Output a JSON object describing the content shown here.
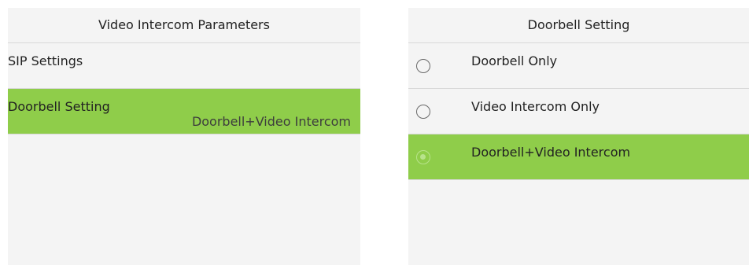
{
  "left_screen": {
    "title": "Video Intercom Parameters",
    "items": [
      {
        "label": "SIP Settings",
        "value": "",
        "selected": false
      },
      {
        "label": "Doorbell Setting",
        "value": "Doorbell+Video Intercom",
        "selected": true
      }
    ]
  },
  "right_screen": {
    "title": "Doorbell Setting",
    "options": [
      {
        "label": "Doorbell Only",
        "checked": false
      },
      {
        "label": "Video Intercom Only",
        "checked": false
      },
      {
        "label": "Doorbell+Video Intercom",
        "checked": true
      }
    ]
  },
  "colors": {
    "panel_bg": "#f4f4f4",
    "selected_bg": "#8fcd4a",
    "divider": "#d8d8d8",
    "radio_checked": "#b8e38c"
  }
}
